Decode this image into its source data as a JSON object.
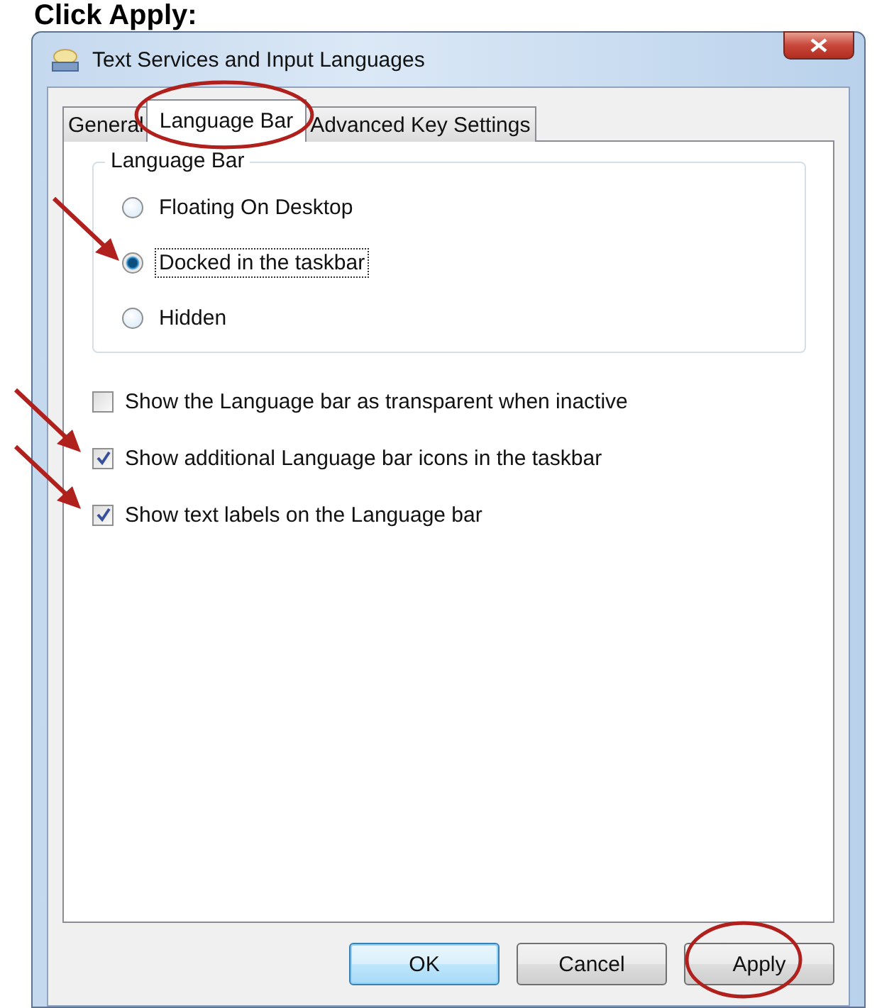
{
  "heading": "Click Apply:",
  "window": {
    "title": "Text Services and Input Languages"
  },
  "tabs": [
    {
      "label": "General",
      "selected": false,
      "circled": false
    },
    {
      "label": "Language Bar",
      "selected": true,
      "circled": true
    },
    {
      "label": "Advanced Key Settings",
      "selected": false,
      "circled": false
    }
  ],
  "group": {
    "title": "Language Bar",
    "options": [
      {
        "label": "Floating On Desktop",
        "selected": false,
        "arrowed": false
      },
      {
        "label": "Docked in the taskbar",
        "selected": true,
        "arrowed": true
      },
      {
        "label": "Hidden",
        "selected": false,
        "arrowed": false
      }
    ]
  },
  "checkboxes": [
    {
      "label": "Show the Language bar as transparent when inactive",
      "checked": false,
      "arrowed": false
    },
    {
      "label": "Show additional Language bar icons in the taskbar",
      "checked": true,
      "arrowed": true
    },
    {
      "label": "Show text labels on the Language bar",
      "checked": true,
      "arrowed": true
    }
  ],
  "buttons": [
    {
      "label": "OK",
      "kind": "default",
      "circled": false
    },
    {
      "label": "Cancel",
      "kind": "normal",
      "circled": false
    },
    {
      "label": "Apply",
      "kind": "normal",
      "circled": true
    }
  ]
}
